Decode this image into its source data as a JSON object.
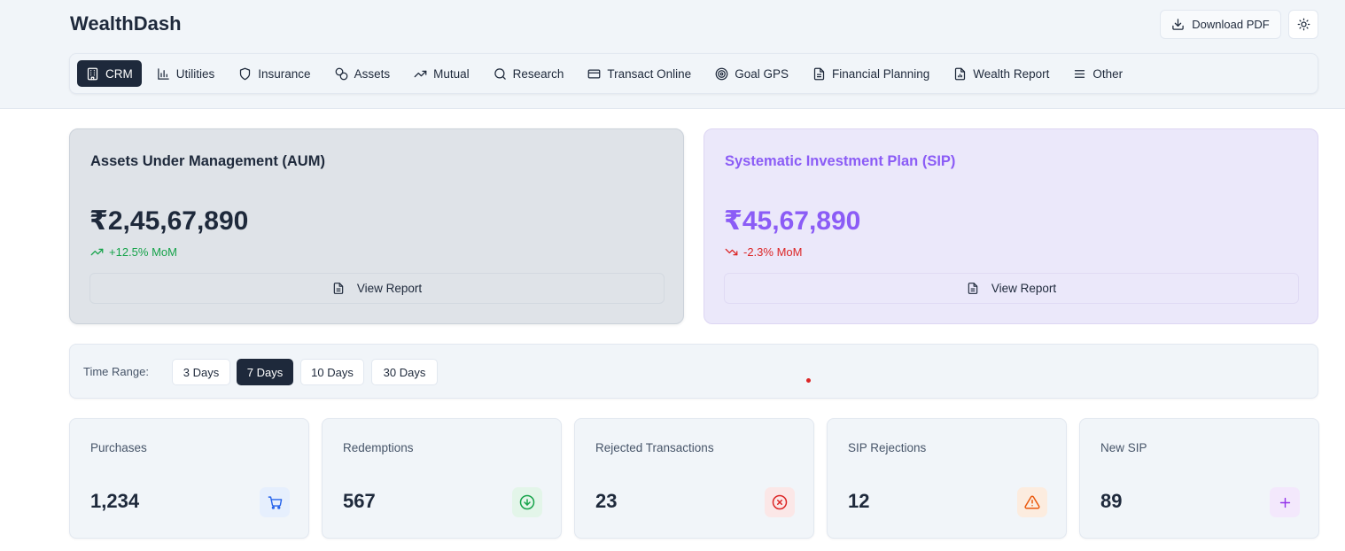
{
  "app": {
    "brand": "WealthDash"
  },
  "header": {
    "download_label": "Download PDF"
  },
  "nav": {
    "items": [
      {
        "label": "CRM",
        "icon": "building-icon",
        "active": true
      },
      {
        "label": "Utilities",
        "icon": "bar-chart-icon"
      },
      {
        "label": "Insurance",
        "icon": "shield-icon"
      },
      {
        "label": "Assets",
        "icon": "coins-icon"
      },
      {
        "label": "Mutual",
        "icon": "trending-up-icon"
      },
      {
        "label": "Research",
        "icon": "search-icon"
      },
      {
        "label": "Transact Online",
        "icon": "credit-card-icon"
      },
      {
        "label": "Goal GPS",
        "icon": "target-icon"
      },
      {
        "label": "Financial Planning",
        "icon": "file-text-icon"
      },
      {
        "label": "Wealth Report",
        "icon": "file-chart-icon"
      },
      {
        "label": "Other",
        "icon": "menu-icon"
      }
    ]
  },
  "cards": {
    "aum": {
      "title": "Assets Under Management (AUM)",
      "value": "₹2,45,67,890",
      "change": "+12.5% MoM",
      "trend": "up",
      "report_label": "View Report"
    },
    "sip": {
      "title": "Systematic Investment Plan (SIP)",
      "value": "₹45,67,890",
      "change": "-2.3% MoM",
      "trend": "down",
      "report_label": "View Report"
    }
  },
  "time_range": {
    "label": "Time Range:",
    "options": [
      "3 Days",
      "7 Days",
      "10 Days",
      "30 Days"
    ],
    "selected": "7 Days"
  },
  "stats": [
    {
      "label": "Purchases",
      "value": "1,234",
      "icon": "shopping-cart-icon",
      "color": "#2563eb"
    },
    {
      "label": "Redemptions",
      "value": "567",
      "icon": "arrow-down-circle-icon",
      "color": "#16a34a"
    },
    {
      "label": "Rejected Transactions",
      "value": "23",
      "icon": "x-circle-icon",
      "color": "#dc2626"
    },
    {
      "label": "SIP Rejections",
      "value": "12",
      "icon": "alert-triangle-icon",
      "color": "#ea580c"
    },
    {
      "label": "New SIP",
      "value": "89",
      "icon": "plus-icon",
      "color": "#9333ea"
    }
  ],
  "colors": {
    "primary": "#1e293b",
    "sip_accent": "#8b5cf6",
    "positive": "#16a34a",
    "negative": "#dc2626"
  }
}
